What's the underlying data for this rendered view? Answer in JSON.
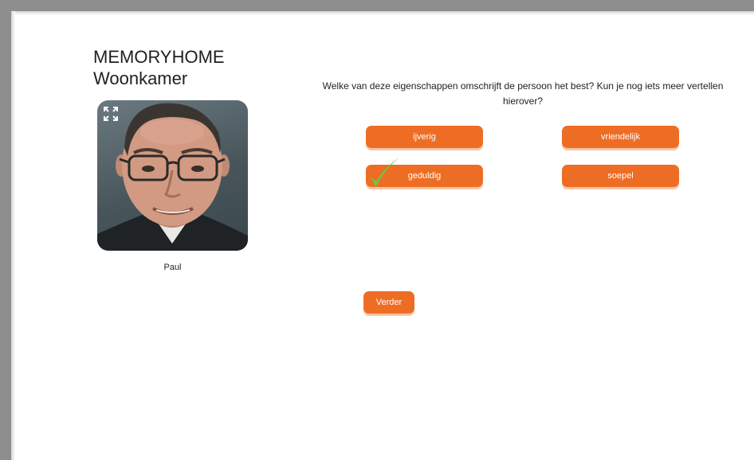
{
  "app": {
    "brand": "MEMORYHOME",
    "room": "Woonkamer"
  },
  "person": {
    "name": "Paul",
    "expand_icon": "expand-icon"
  },
  "question": {
    "text": "Welke van deze eigenschappen omschrijft de persoon het best? Kun je nog iets meer vertellen hierover?"
  },
  "options": [
    {
      "label": "ijverig",
      "selected": false
    },
    {
      "label": "vriendelijk",
      "selected": false
    },
    {
      "label": "geduldig",
      "selected": true
    },
    {
      "label": "soepel",
      "selected": false
    }
  ],
  "actions": {
    "next_label": "Verder"
  },
  "colors": {
    "accent": "#ee6d24",
    "check": "#5cd23f"
  }
}
